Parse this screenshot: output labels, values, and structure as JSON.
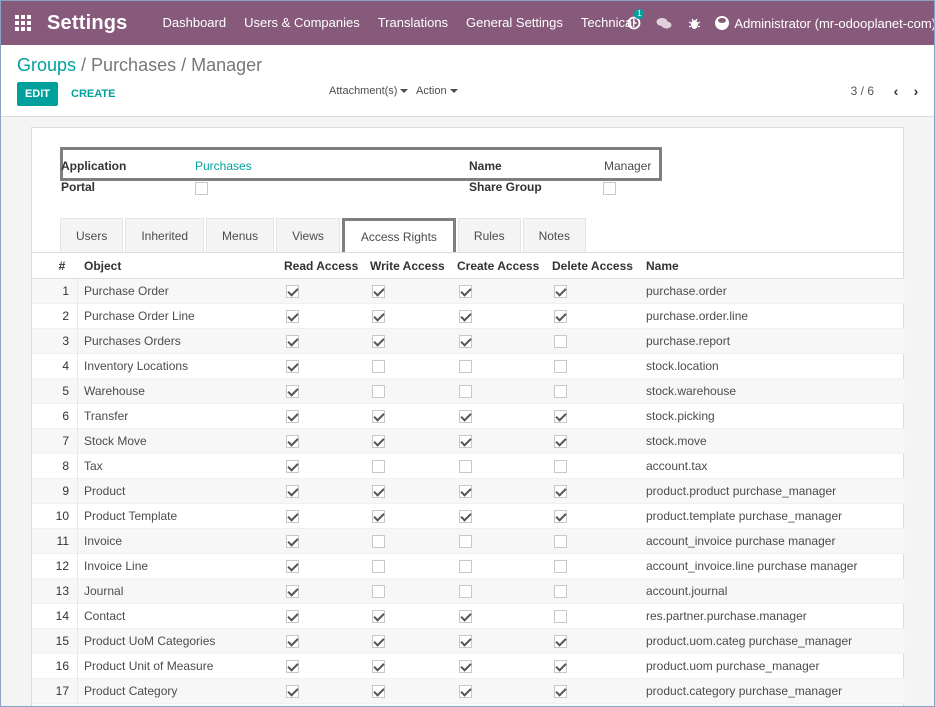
{
  "navbar": {
    "app_title": "Settings",
    "menu": [
      "Dashboard",
      "Users & Companies",
      "Translations",
      "General Settings",
      "Technical"
    ],
    "activity_badge": "1",
    "user": "Administrator (mr-odooplanet-com)",
    "color": "#875a7b"
  },
  "breadcrumb": {
    "parent": "Groups",
    "current": "Purchases / Manager"
  },
  "toolbar": {
    "edit_label": "EDIT",
    "create_label": "CREATE",
    "attachments_label": "Attachment(s)",
    "action_label": "Action"
  },
  "pager": {
    "value": "3 / 6"
  },
  "form": {
    "application_label": "Application",
    "application_value": "Purchases",
    "name_label": "Name",
    "name_value": "Manager",
    "portal_label": "Portal",
    "share_group_label": "Share Group",
    "portal_checked": false,
    "share_group_checked": false
  },
  "tabs": [
    "Users",
    "Inherited",
    "Menus",
    "Views",
    "Access Rights",
    "Rules",
    "Notes"
  ],
  "active_tab": "Access Rights",
  "table": {
    "headers": [
      "#",
      "Object",
      "Read Access",
      "Write Access",
      "Create Access",
      "Delete Access",
      "Name"
    ],
    "rows": [
      {
        "num": "1",
        "object": "Purchase Order",
        "read": true,
        "write": true,
        "create": true,
        "delete": true,
        "name": "purchase.order"
      },
      {
        "num": "2",
        "object": "Purchase Order Line",
        "read": true,
        "write": true,
        "create": true,
        "delete": true,
        "name": "purchase.order.line"
      },
      {
        "num": "3",
        "object": "Purchases Orders",
        "read": true,
        "write": true,
        "create": true,
        "delete": false,
        "name": "purchase.report"
      },
      {
        "num": "4",
        "object": "Inventory Locations",
        "read": true,
        "write": false,
        "create": false,
        "delete": false,
        "name": "stock.location"
      },
      {
        "num": "5",
        "object": "Warehouse",
        "read": true,
        "write": false,
        "create": false,
        "delete": false,
        "name": "stock.warehouse"
      },
      {
        "num": "6",
        "object": "Transfer",
        "read": true,
        "write": true,
        "create": true,
        "delete": true,
        "name": "stock.picking"
      },
      {
        "num": "7",
        "object": "Stock Move",
        "read": true,
        "write": true,
        "create": true,
        "delete": true,
        "name": "stock.move"
      },
      {
        "num": "8",
        "object": "Tax",
        "read": true,
        "write": false,
        "create": false,
        "delete": false,
        "name": "account.tax"
      },
      {
        "num": "9",
        "object": "Product",
        "read": true,
        "write": true,
        "create": true,
        "delete": true,
        "name": "product.product purchase_manager"
      },
      {
        "num": "10",
        "object": "Product Template",
        "read": true,
        "write": true,
        "create": true,
        "delete": true,
        "name": "product.template purchase_manager"
      },
      {
        "num": "11",
        "object": "Invoice",
        "read": true,
        "write": false,
        "create": false,
        "delete": false,
        "name": "account_invoice purchase manager"
      },
      {
        "num": "12",
        "object": "Invoice Line",
        "read": true,
        "write": false,
        "create": false,
        "delete": false,
        "name": "account_invoice.line purchase manager"
      },
      {
        "num": "13",
        "object": "Journal",
        "read": true,
        "write": false,
        "create": false,
        "delete": false,
        "name": "account.journal"
      },
      {
        "num": "14",
        "object": "Contact",
        "read": true,
        "write": true,
        "create": true,
        "delete": false,
        "name": "res.partner.purchase.manager"
      },
      {
        "num": "15",
        "object": "Product UoM Categories",
        "read": true,
        "write": true,
        "create": true,
        "delete": true,
        "name": "product.uom.categ purchase_manager"
      },
      {
        "num": "16",
        "object": "Product Unit of Measure",
        "read": true,
        "write": true,
        "create": true,
        "delete": true,
        "name": "product.uom purchase_manager"
      },
      {
        "num": "17",
        "object": "Product Category",
        "read": true,
        "write": true,
        "create": true,
        "delete": true,
        "name": "product.category purchase_manager"
      }
    ]
  }
}
